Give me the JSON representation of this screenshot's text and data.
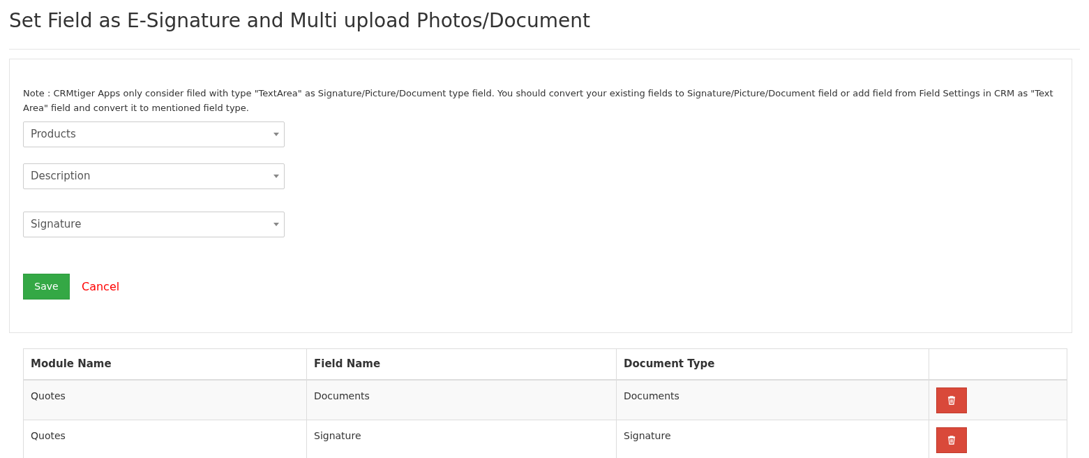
{
  "title": "Set Field as E-Signature and Multi upload Photos/Document",
  "note": "Note : CRMtiger Apps only consider filed with type \"TextArea\" as Signature/Picture/Document type field. You should convert your existing fields to Signature/Picture/Document field or add field from Field Settings in CRM as \"Text Area\" field and convert it to mentioned field type.",
  "selects": [
    {
      "value": "Products"
    },
    {
      "value": "Description"
    },
    {
      "value": "Signature"
    }
  ],
  "buttons": {
    "save": "Save",
    "cancel": "Cancel"
  },
  "table": {
    "columns": [
      "Module Name",
      "Field Name",
      "Document Type"
    ],
    "rows": [
      {
        "cells": [
          "Quotes",
          "Documents",
          "Documents"
        ]
      },
      {
        "cells": [
          "Quotes",
          "Signature",
          "Signature"
        ]
      }
    ]
  }
}
